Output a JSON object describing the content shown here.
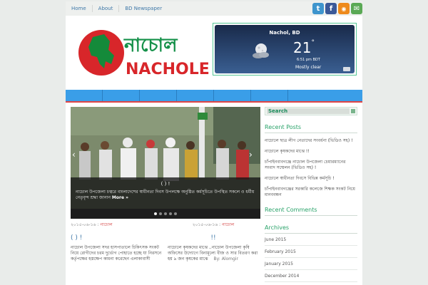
{
  "topnav": [
    "Home",
    "About",
    "BD Newspaper"
  ],
  "social": {
    "twitter": {
      "icon": "twitter-icon",
      "glyph": "t",
      "color": "#3e95cd"
    },
    "facebook": {
      "icon": "facebook-icon",
      "glyph": "f",
      "color": "#3b5998"
    },
    "rss": {
      "icon": "rss-icon",
      "glyph": "◉",
      "color": "#ee8a1c"
    },
    "email": {
      "icon": "email-icon",
      "glyph": "✉",
      "color": "#5aa955"
    }
  },
  "logo": {
    "bangla": "নাচোল",
    "latin": "NACHOLE"
  },
  "weather": {
    "location": "Nachol, BD",
    "temp": "21",
    "degree": "°",
    "time": "6:51 pm BDT",
    "condition": "Mostly clear",
    "icon": "moon-cloud-icon"
  },
  "slider": {
    "title": "(        ) !",
    "text": "নাচোল উপজেলা চত্বরে বাংলাদেশের স্বাধীনতা দিবস উপলক্ষে অনুষ্ঠিত কর্মসূচিতে উপস্থিত সকলে ও ধর্মীয় নেতৃবৃন্দ শ্রদ্ধা জানান",
    "more": "More »",
    "prev": "‹",
    "next": "›",
    "dots": [
      true,
      false,
      false,
      false,
      false
    ]
  },
  "posts": [
    {
      "date": "২০১৫-০৬-১৬",
      "sep": ":",
      "category": "নাচোল",
      "title": "(        ) !",
      "text": "নাচোল উপজেলা সদর হাসপাতালে চিকিৎসক সংকট নিয়ে রোগীদের চরম দুর্ভোগ পোহাতে হচ্ছে যা নিরসনে কর্তৃপক্ষের হস্তক্ষেপ কামনা করেছেন এলাকাবাসী"
    },
    {
      "date": "২০১৫-০৬-১৬",
      "sep": ":",
      "category": "নাচোল",
      "title": "!!",
      "text": "নাচোলে কৃষকদের মাঝে ..নাচোল উপজেলা কৃষি অফিসের উদ্যোগে বিনামূল্যে বীজ ও সার বিতরণ করা হয় ৯ জন কৃষকের মাঝে",
      "byline": "By: Alomgir"
    }
  ],
  "sidebar": {
    "search_label": "Search",
    "recent_posts_heading": "Recent Posts",
    "recent_posts": [
      "নাচোলে ছাত্র লীগ নেতাদের সংবর্ধনা (ভিডিও সহ) !",
      "নাচোলে কৃষকদের মাঝে !!",
      "চাঁপাইনবাবগঞ্জে নাচোল উপজেলা চেয়ারম্যানের সংবাদ সম্মেলন (ভিডিও সহ) !",
      "নাচোলে স্বাধীনতা দিবসে বিভিন্ন কর্মসূচি !",
      "চাঁপাইনবাবগঞ্জের সরকারি কলেজে শিক্ষক সংকট নিয়ে মানববন্ধন"
    ],
    "recent_comments_heading": "Recent Comments",
    "archives_heading": "Archives",
    "archives": [
      "June 2015",
      "February 2015",
      "January 2015",
      "December 2014"
    ]
  }
}
